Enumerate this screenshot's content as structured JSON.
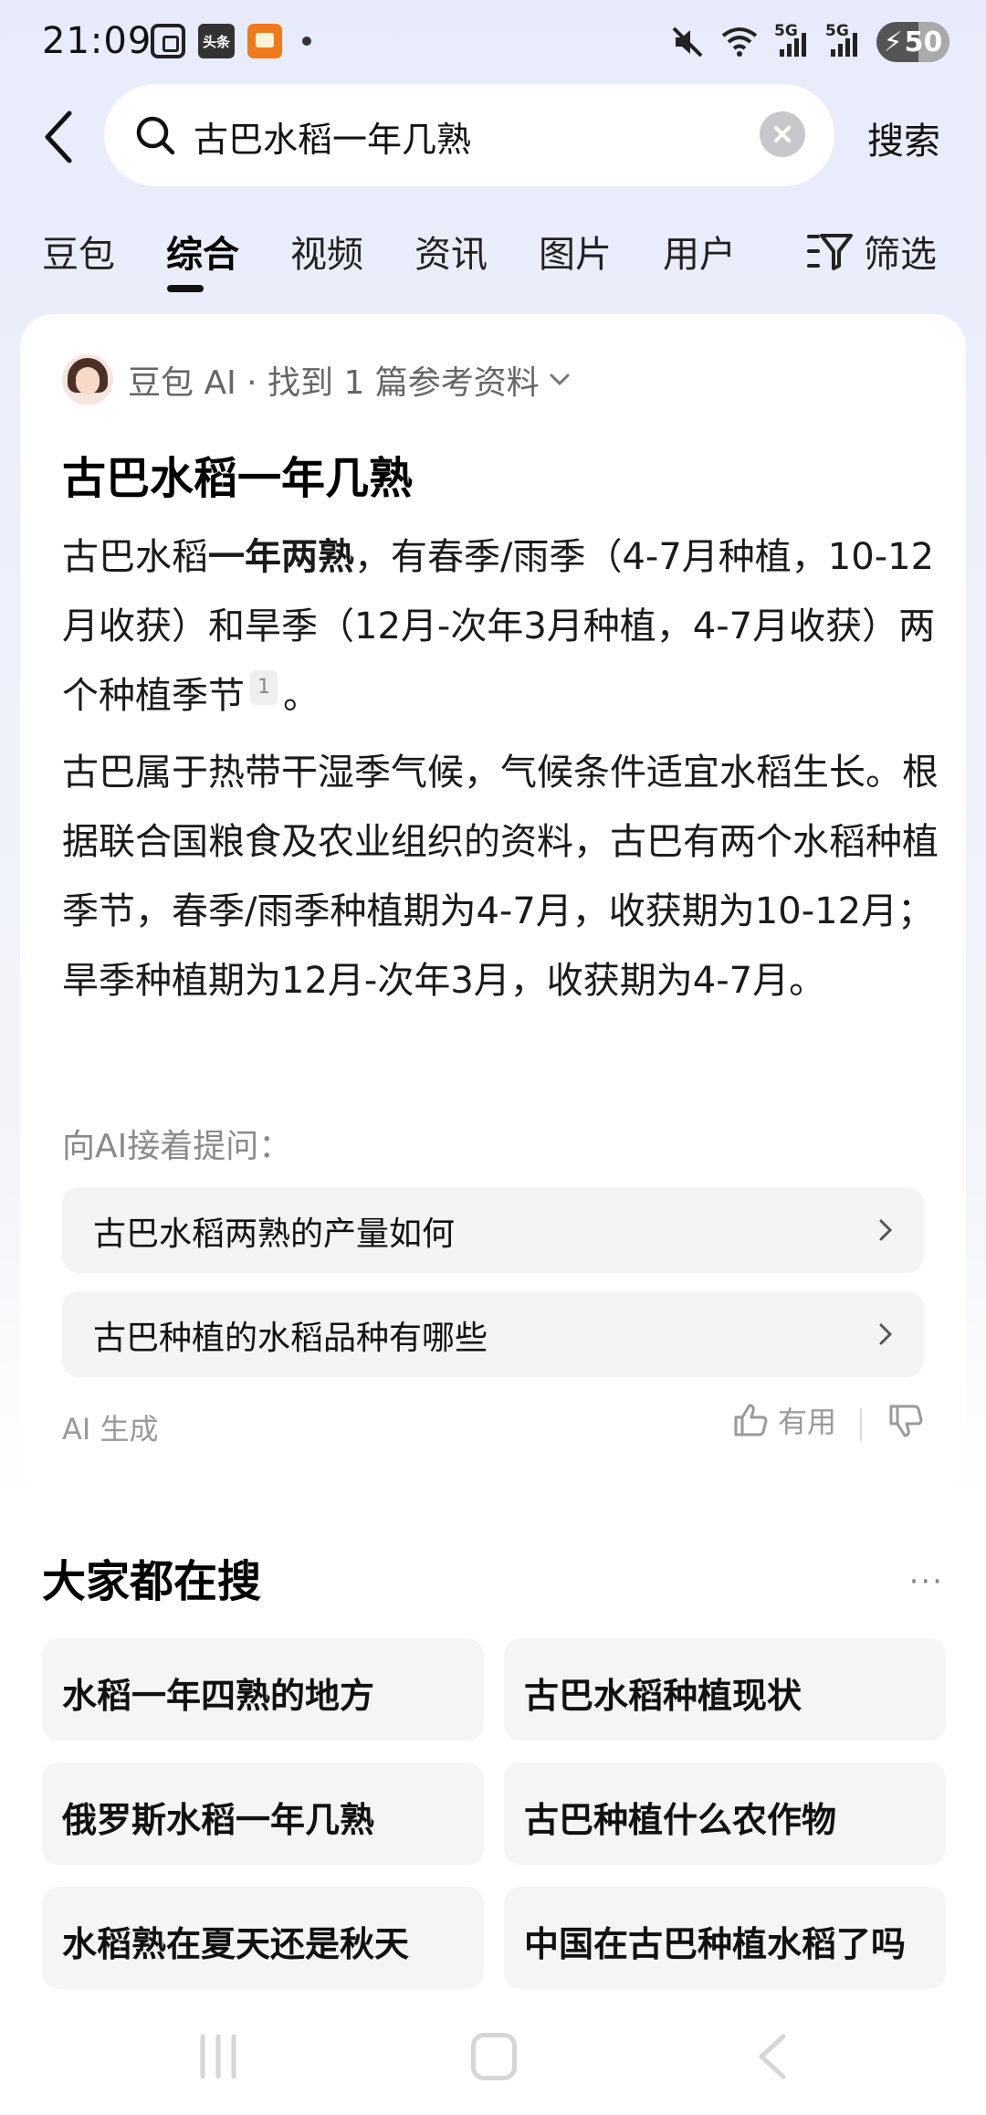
{
  "status_bar": {
    "time": "21:09",
    "toutiao_label": "头条",
    "net1": "5G",
    "net2": "5G",
    "battery": "50"
  },
  "search": {
    "query": "古巴水稻一年几熟",
    "submit_label": "搜索"
  },
  "tabs": [
    {
      "label": "豆包"
    },
    {
      "label": "综合"
    },
    {
      "label": "视频"
    },
    {
      "label": "资讯"
    },
    {
      "label": "图片"
    },
    {
      "label": "用户"
    }
  ],
  "filter_label": "筛选",
  "ai_card": {
    "source": "豆包 AI · 找到 1 篇参考资料",
    "title": "古巴水稻一年几熟",
    "para1_before": "古巴水稻",
    "para1_bold": "一年两熟",
    "para1_after": "，有春季/雨季（4-7月种植，10-12月收获）和旱季（12月-次年3月种植，4-7月收获）两个种植季节",
    "ref_number": "1",
    "para1_end": "。",
    "para2": "古巴属于热带干湿季气候，气候条件适宜水稻生长。根据联合国粮食及农业组织的资料，古巴有两个水稻种植季节，春季/雨季种植期为4-7月，收获期为10-12月；旱季种植期为12月-次年3月，收获期为4-7月。",
    "followup_label": "向AI接着提问：",
    "followups": [
      {
        "text": "古巴水稻两熟的产量如何"
      },
      {
        "text": "古巴种植的水稻品种有哪些"
      }
    ],
    "ai_generated_label": "AI 生成",
    "useful_label": "有用"
  },
  "hot_searches": {
    "title": "大家都在搜",
    "more_label": "···",
    "items": [
      {
        "text": "水稻一年四熟的地方"
      },
      {
        "text": "古巴水稻种植现状"
      },
      {
        "text": "俄罗斯水稻一年几熟"
      },
      {
        "text": "古巴种植什么农作物"
      },
      {
        "text": "水稻熟在夏天还是秋天"
      },
      {
        "text": "中国在古巴种植水稻了吗"
      }
    ]
  }
}
